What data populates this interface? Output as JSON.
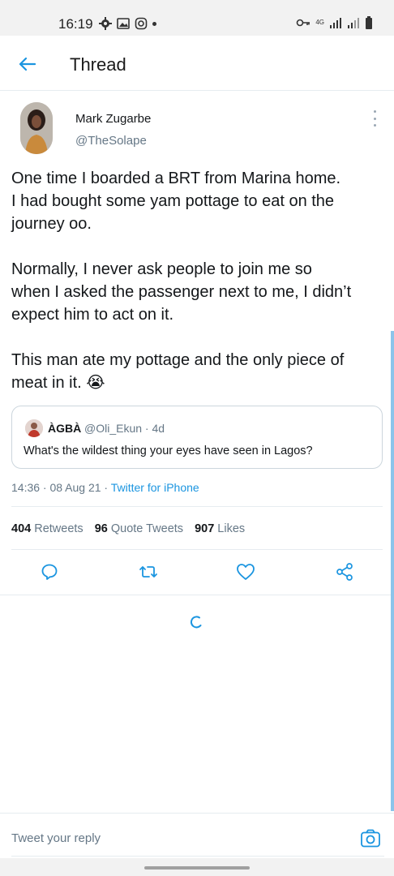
{
  "status_bar": {
    "time": "16:19",
    "network": "4G"
  },
  "header": {
    "title": "Thread"
  },
  "tweet": {
    "author_name": "Mark Zugarbe",
    "author_handle": "@TheSolape",
    "paragraphs": [
      "One time I boarded a BRT from Marina home.\nI had bought some yam pottage to eat on the\njourney oo.",
      "Normally, I never ask people to join me so\nwhen I asked the passenger next to me, I didn’t\nexpect him to act on it.",
      "This man ate my pottage and the only piece of\nmeat in it. 😭"
    ],
    "quoted": {
      "name": "ÀGBÀ",
      "meta": "@Oli_Ekun · 4d",
      "text": "What's the wildest thing your eyes have seen in Lagos?"
    },
    "timestamp": "14:36 · 08 Aug 21 · ",
    "source": "Twitter for iPhone",
    "stats": {
      "retweets_count": "404",
      "retweets_label": "Retweets",
      "quotes_count": "96",
      "quotes_label": "Quote Tweets",
      "likes_count": "907",
      "likes_label": "Likes"
    }
  },
  "reply": {
    "placeholder": "Tweet your reply"
  },
  "colors": {
    "accent": "#1b95e0",
    "secondary_text": "#657786",
    "divider": "#e6ecf0"
  }
}
